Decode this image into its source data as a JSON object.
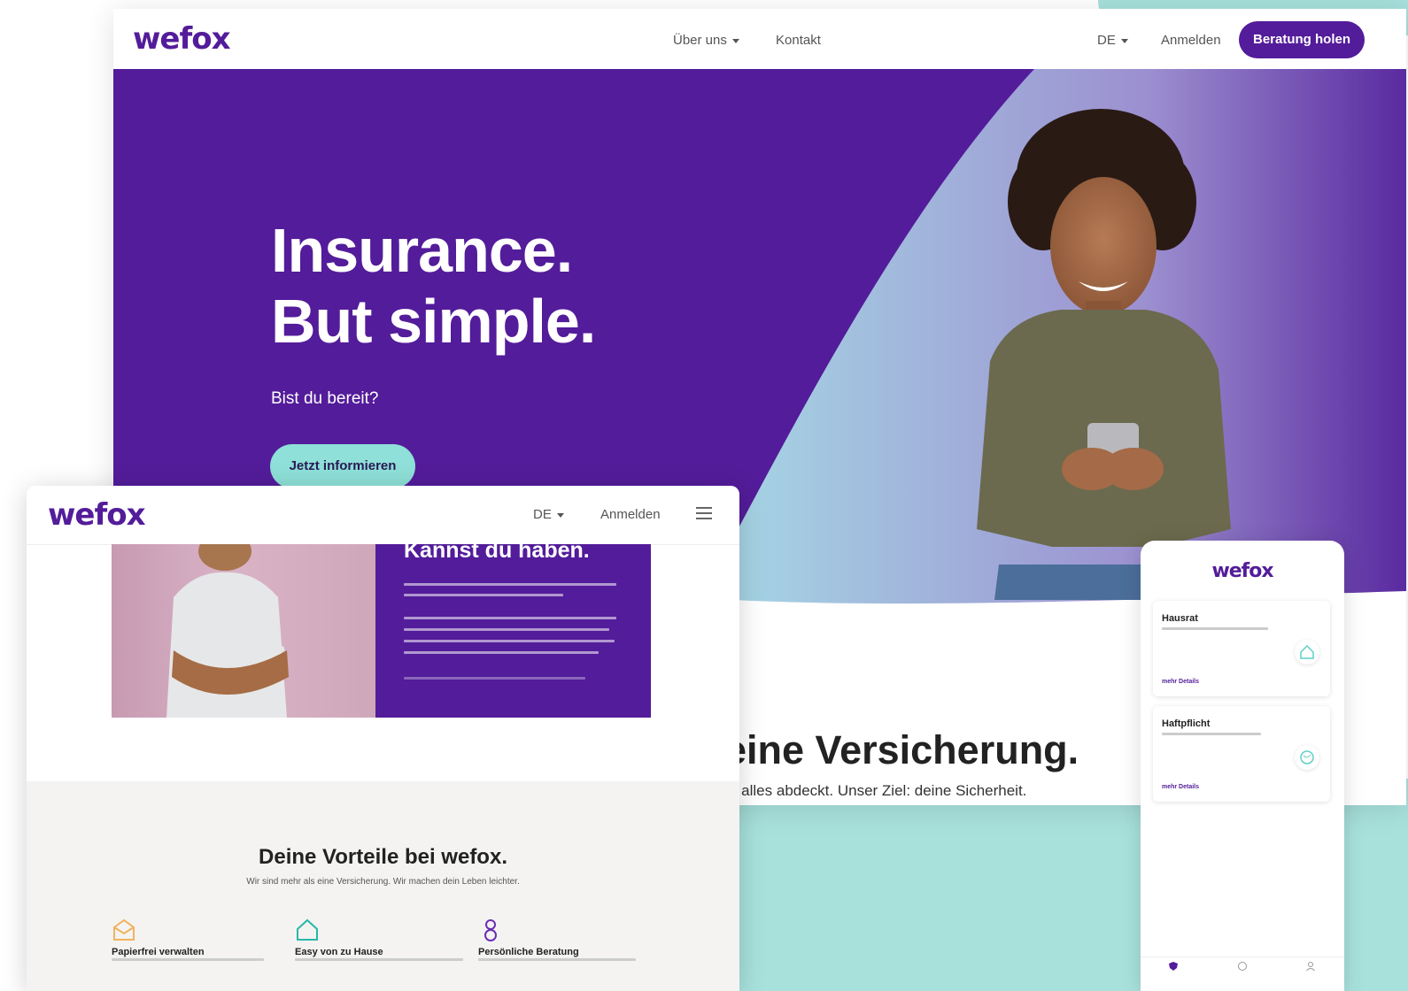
{
  "colors": {
    "brand_purple": "#531c9a",
    "teal": "#8ee0d8",
    "teal_backdrop": "#a8e1dc"
  },
  "desktop": {
    "logo": "wefox",
    "nav": {
      "about": "Über uns",
      "contact": "Kontakt",
      "lang": "DE",
      "login": "Anmelden",
      "cta": "Beratung holen"
    },
    "hero": {
      "title_line1": "Insurance.",
      "title_line2": "But simple.",
      "subtitle": "Bist du bereit?",
      "cta": "Jetzt informieren"
    },
    "section": {
      "title": "eine Versicherung.",
      "subtitle": "e alles abdeckt. Unser Ziel: deine Sicherheit."
    }
  },
  "tablet": {
    "logo": "wefox",
    "nav": {
      "lang": "DE",
      "login": "Anmelden",
      "menu_icon": "hamburger-icon"
    },
    "promo": {
      "heading": "Kannst du haben."
    },
    "benefits": {
      "title": "Deine Vorteile bei wefox.",
      "subtitle": "Wir sind mehr als eine Versicherung. Wir machen dein Leben leichter.",
      "features": [
        {
          "icon": "envelope-icon",
          "title": "Papierfrei verwalten"
        },
        {
          "icon": "house-icon",
          "title": "Easy von zu Hause"
        },
        {
          "icon": "person-icon",
          "title": "Persönliche Beratung"
        }
      ]
    }
  },
  "phone": {
    "logo": "wefox",
    "cards": [
      {
        "title": "Hausrat",
        "icon": "house-icon",
        "link": "mehr Details"
      },
      {
        "title": "Haftpflicht",
        "icon": "globe-icon",
        "link": "mehr Details"
      }
    ]
  }
}
